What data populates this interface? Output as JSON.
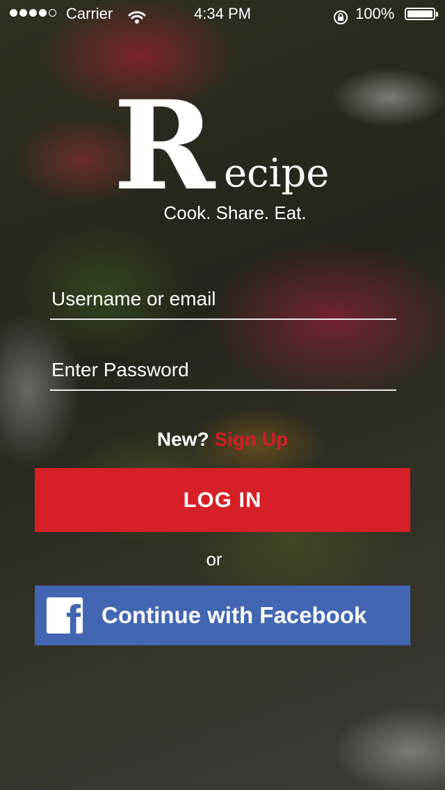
{
  "status_bar": {
    "carrier": "Carrier",
    "time": "4:34 PM",
    "battery": "100%",
    "signal_bars_filled": 4,
    "signal_bars_total": 5,
    "battery_level_percent": 100
  },
  "logo": {
    "initial": "R",
    "rest": "ecipe",
    "tagline": "Cook. Share. Eat."
  },
  "form": {
    "username_placeholder": "Username or email",
    "password_placeholder": "Enter Password"
  },
  "signup": {
    "prompt": "New?",
    "link": "Sign Up"
  },
  "buttons": {
    "login": "LOG IN",
    "or": "or",
    "facebook": "Continue with Facebook",
    "facebook_icon_glyph": "f"
  },
  "colors": {
    "accent_red": "#d52027",
    "facebook_blue": "#4266b2",
    "text": "#ffffff"
  },
  "icons": [
    "signal-dots-icon",
    "wifi-icon",
    "rotation-lock-icon",
    "battery-icon",
    "facebook-icon"
  ]
}
